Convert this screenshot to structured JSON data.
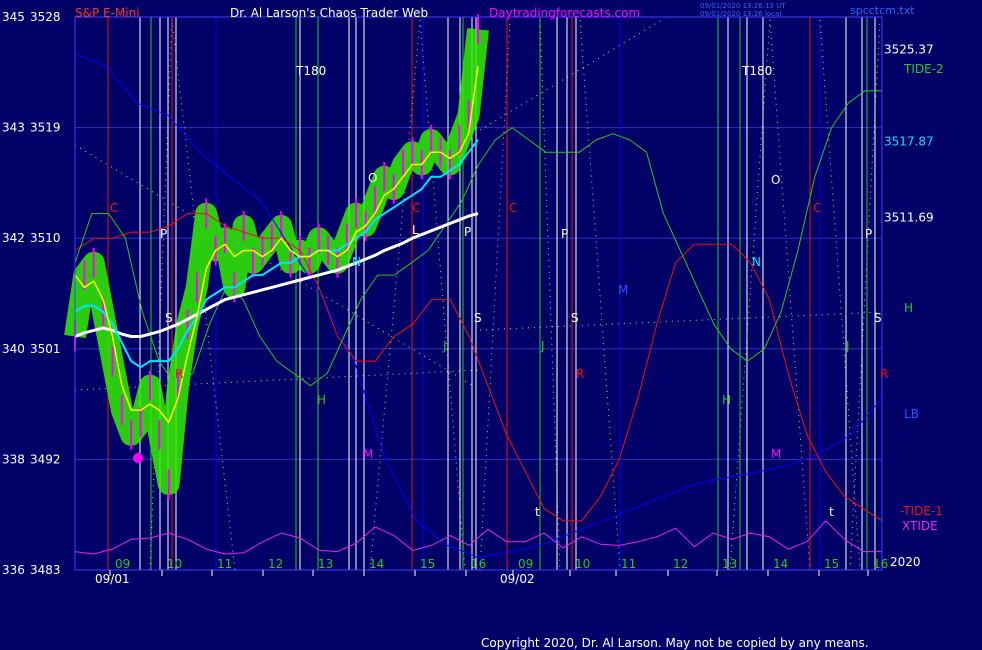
{
  "header": {
    "symbol": "S&P E-Mini",
    "author": "Dr. Al Larson's Chaos Trader Web",
    "site": "Daytradingforecasts.com",
    "stamp_1": "09/01/2020 13:26:13 UT",
    "stamp_2": "09/01/2020 13:26 local",
    "file": "spcctcm.txt"
  },
  "footer": {
    "copyright": "Copyright 2020, Dr. Al Larson. May not be copied by any means."
  },
  "colors": {
    "background": "#000066",
    "axis": "#4040ff",
    "price_bars": "#ff00ff",
    "cloud": "#33ee00",
    "fast_avg": "#ffff00",
    "mid_avg": "#00e5ff",
    "slow_avg": "#ffffff",
    "tide2": "#22cc22",
    "tide1": "#ee1111",
    "xtide": "#ee22ee",
    "lb": "#0000ff",
    "title_red": "#ff3030",
    "title_white": "#ffffff",
    "title_magenta": "#ff00ff"
  },
  "chart_data": {
    "type": "line",
    "title": "S&P E-Mini",
    "left_axis_labels": [
      {
        "ticks": "345",
        "price": "3528",
        "value": 3528
      },
      {
        "ticks": "343",
        "price": "3519",
        "value": 3519
      },
      {
        "ticks": "342",
        "price": "3510",
        "value": 3510
      },
      {
        "ticks": "340",
        "price": "3501",
        "value": 3501
      },
      {
        "ticks": "338",
        "price": "3492",
        "value": 3492
      },
      {
        "ticks": "336",
        "price": "3483",
        "value": 3483
      }
    ],
    "ylim": [
      3483,
      3528
    ],
    "x_hour_ticks": [
      "09",
      "10",
      "11",
      "12",
      "13",
      "14",
      "15",
      "16",
      "09",
      "10",
      "11",
      "12",
      "13",
      "14",
      "15",
      "16"
    ],
    "x_date_labels": [
      "09/01",
      "09/02"
    ],
    "level_labels": [
      {
        "text": "3525.37",
        "value": 3525.37
      },
      {
        "text": "3517.87",
        "value": 3517.87
      },
      {
        "text": "3511.69",
        "value": 3511.69
      }
    ],
    "series_labels": {
      "tide2": "TIDE-2",
      "h": "H",
      "lb": "LB",
      "tide1": "-TIDE-1",
      "xtide": "XTIDE",
      "year": "2020"
    },
    "timing_letters": [
      "C",
      "P",
      "R",
      "S",
      "N",
      "O",
      "J",
      "H",
      "M",
      "L",
      "t",
      "T180"
    ],
    "price_series": [
      3502,
      3507,
      3508,
      3504,
      3500,
      3496,
      3494,
      3495,
      3498,
      3494,
      3490,
      3498,
      3503,
      3506,
      3512,
      3509,
      3510,
      3506,
      3511,
      3508,
      3509,
      3510,
      3511,
      3508,
      3509,
      3508,
      3510,
      3509,
      3508,
      3510,
      3512,
      3511,
      3513,
      3515,
      3514,
      3516,
      3517,
      3516,
      3518,
      3517,
      3516,
      3518,
      3520,
      3527
    ],
    "fast_avg": [
      3507,
      3506,
      3506.5,
      3505,
      3502,
      3498,
      3496,
      3496,
      3496.5,
      3496,
      3495,
      3497,
      3500.5,
      3503.5,
      3507.5,
      3509,
      3509.5,
      3508.5,
      3509,
      3509,
      3508.5,
      3509,
      3510,
      3509,
      3508.5,
      3508.5,
      3509,
      3509,
      3508.5,
      3509,
      3510.5,
      3511,
      3512,
      3513.5,
      3514,
      3515,
      3516,
      3516,
      3517,
      3517,
      3516.5,
      3517,
      3518.5,
      3524
    ],
    "mid_avg": [
      3504,
      3504.5,
      3504.5,
      3504,
      3503,
      3501.5,
      3500,
      3499.5,
      3500,
      3500,
      3500,
      3501,
      3502.5,
      3503.5,
      3505,
      3505.5,
      3506,
      3506,
      3506.5,
      3507,
      3507,
      3507.5,
      3508,
      3508,
      3508.5,
      3508.5,
      3509,
      3509,
      3509,
      3509.5,
      3510,
      3510.5,
      3511.5,
      3512,
      3512.5,
      3513,
      3513.5,
      3514,
      3515,
      3515,
      3515.5,
      3516,
      3517,
      3518
    ],
    "slow_avg": [
      3502,
      3502.3,
      3502.5,
      3502.7,
      3502.5,
      3502.2,
      3502,
      3502,
      3502.2,
      3502.4,
      3502.7,
      3503,
      3503.4,
      3503.8,
      3504.2,
      3504.6,
      3505,
      3505.2,
      3505.4,
      3505.6,
      3505.8,
      3506,
      3506.2,
      3506.4,
      3506.6,
      3506.8,
      3507,
      3507.2,
      3507.4,
      3507.7,
      3508,
      3508.3,
      3508.6,
      3509,
      3509.3,
      3509.6,
      3510,
      3510.3,
      3510.6,
      3510.9,
      3511.2,
      3511.5,
      3511.8,
      3512
    ],
    "tide2": [
      3508,
      3512,
      3512,
      3510,
      3504,
      3500,
      3498,
      3499,
      3503,
      3506,
      3505,
      3502,
      3500,
      3499,
      3498,
      3499,
      3502,
      3505,
      3507,
      3507,
      3508,
      3509,
      3511,
      3513,
      3516,
      3518,
      3519,
      3518,
      3517,
      3517,
      3517,
      3518,
      3518.5,
      3518,
      3517,
      3512,
      3509,
      3506,
      3503,
      3501,
      3500,
      3501,
      3504,
      3509,
      3515,
      3519,
      3521,
      3522,
      3522
    ],
    "tide1": [
      3509,
      3510,
      3510,
      3510.5,
      3510.5,
      3511,
      3512,
      3512,
      3511,
      3510.5,
      3510,
      3510,
      3509,
      3506,
      3502,
      3500,
      3500,
      3502,
      3503,
      3505,
      3505,
      3502,
      3498,
      3494,
      3491,
      3488,
      3487,
      3487,
      3489,
      3492,
      3497,
      3503,
      3508,
      3509.5,
      3509.5,
      3509.5,
      3508,
      3505,
      3499,
      3494,
      3491,
      3489,
      3488,
      3487
    ],
    "xtide": [
      3484.5,
      3484.3,
      3484.7,
      3485.5,
      3485.6,
      3486,
      3485.5,
      3484.7,
      3484.3,
      3484.4,
      3485.3,
      3486,
      3485.6,
      3484.6,
      3484.5,
      3485.2,
      3486.5,
      3485.8,
      3484.6,
      3485,
      3485.8,
      3485,
      3486.3,
      3485.3,
      3485.3,
      3486,
      3484.8,
      3485.7,
      3485.1,
      3485,
      3485.3,
      3485.7,
      3486.4,
      3484.9,
      3486,
      3485.5,
      3486,
      3485.7,
      3484.7,
      3485.3,
      3487,
      3485.5,
      3484.5,
      3484.5
    ],
    "lb": [
      3525,
      3524,
      3521,
      3520,
      3517,
      3515,
      3513,
      3509,
      3505,
      3500,
      3492,
      3487,
      3485,
      3484,
      3484.5,
      3485,
      3486,
      3487,
      3488,
      3489,
      3490,
      3490.5,
      3491,
      3491.5,
      3492.5,
      3494,
      3497
    ],
    "price_ticks": [
      {
        "label": "3528",
        "value": 3528
      },
      {
        "label": "3519",
        "value": 3519
      },
      {
        "label": "3510",
        "value": 3510
      },
      {
        "label": "3501",
        "value": 3501
      },
      {
        "label": "3492",
        "value": 3492
      },
      {
        "label": "3483",
        "value": 3483
      }
    ]
  }
}
